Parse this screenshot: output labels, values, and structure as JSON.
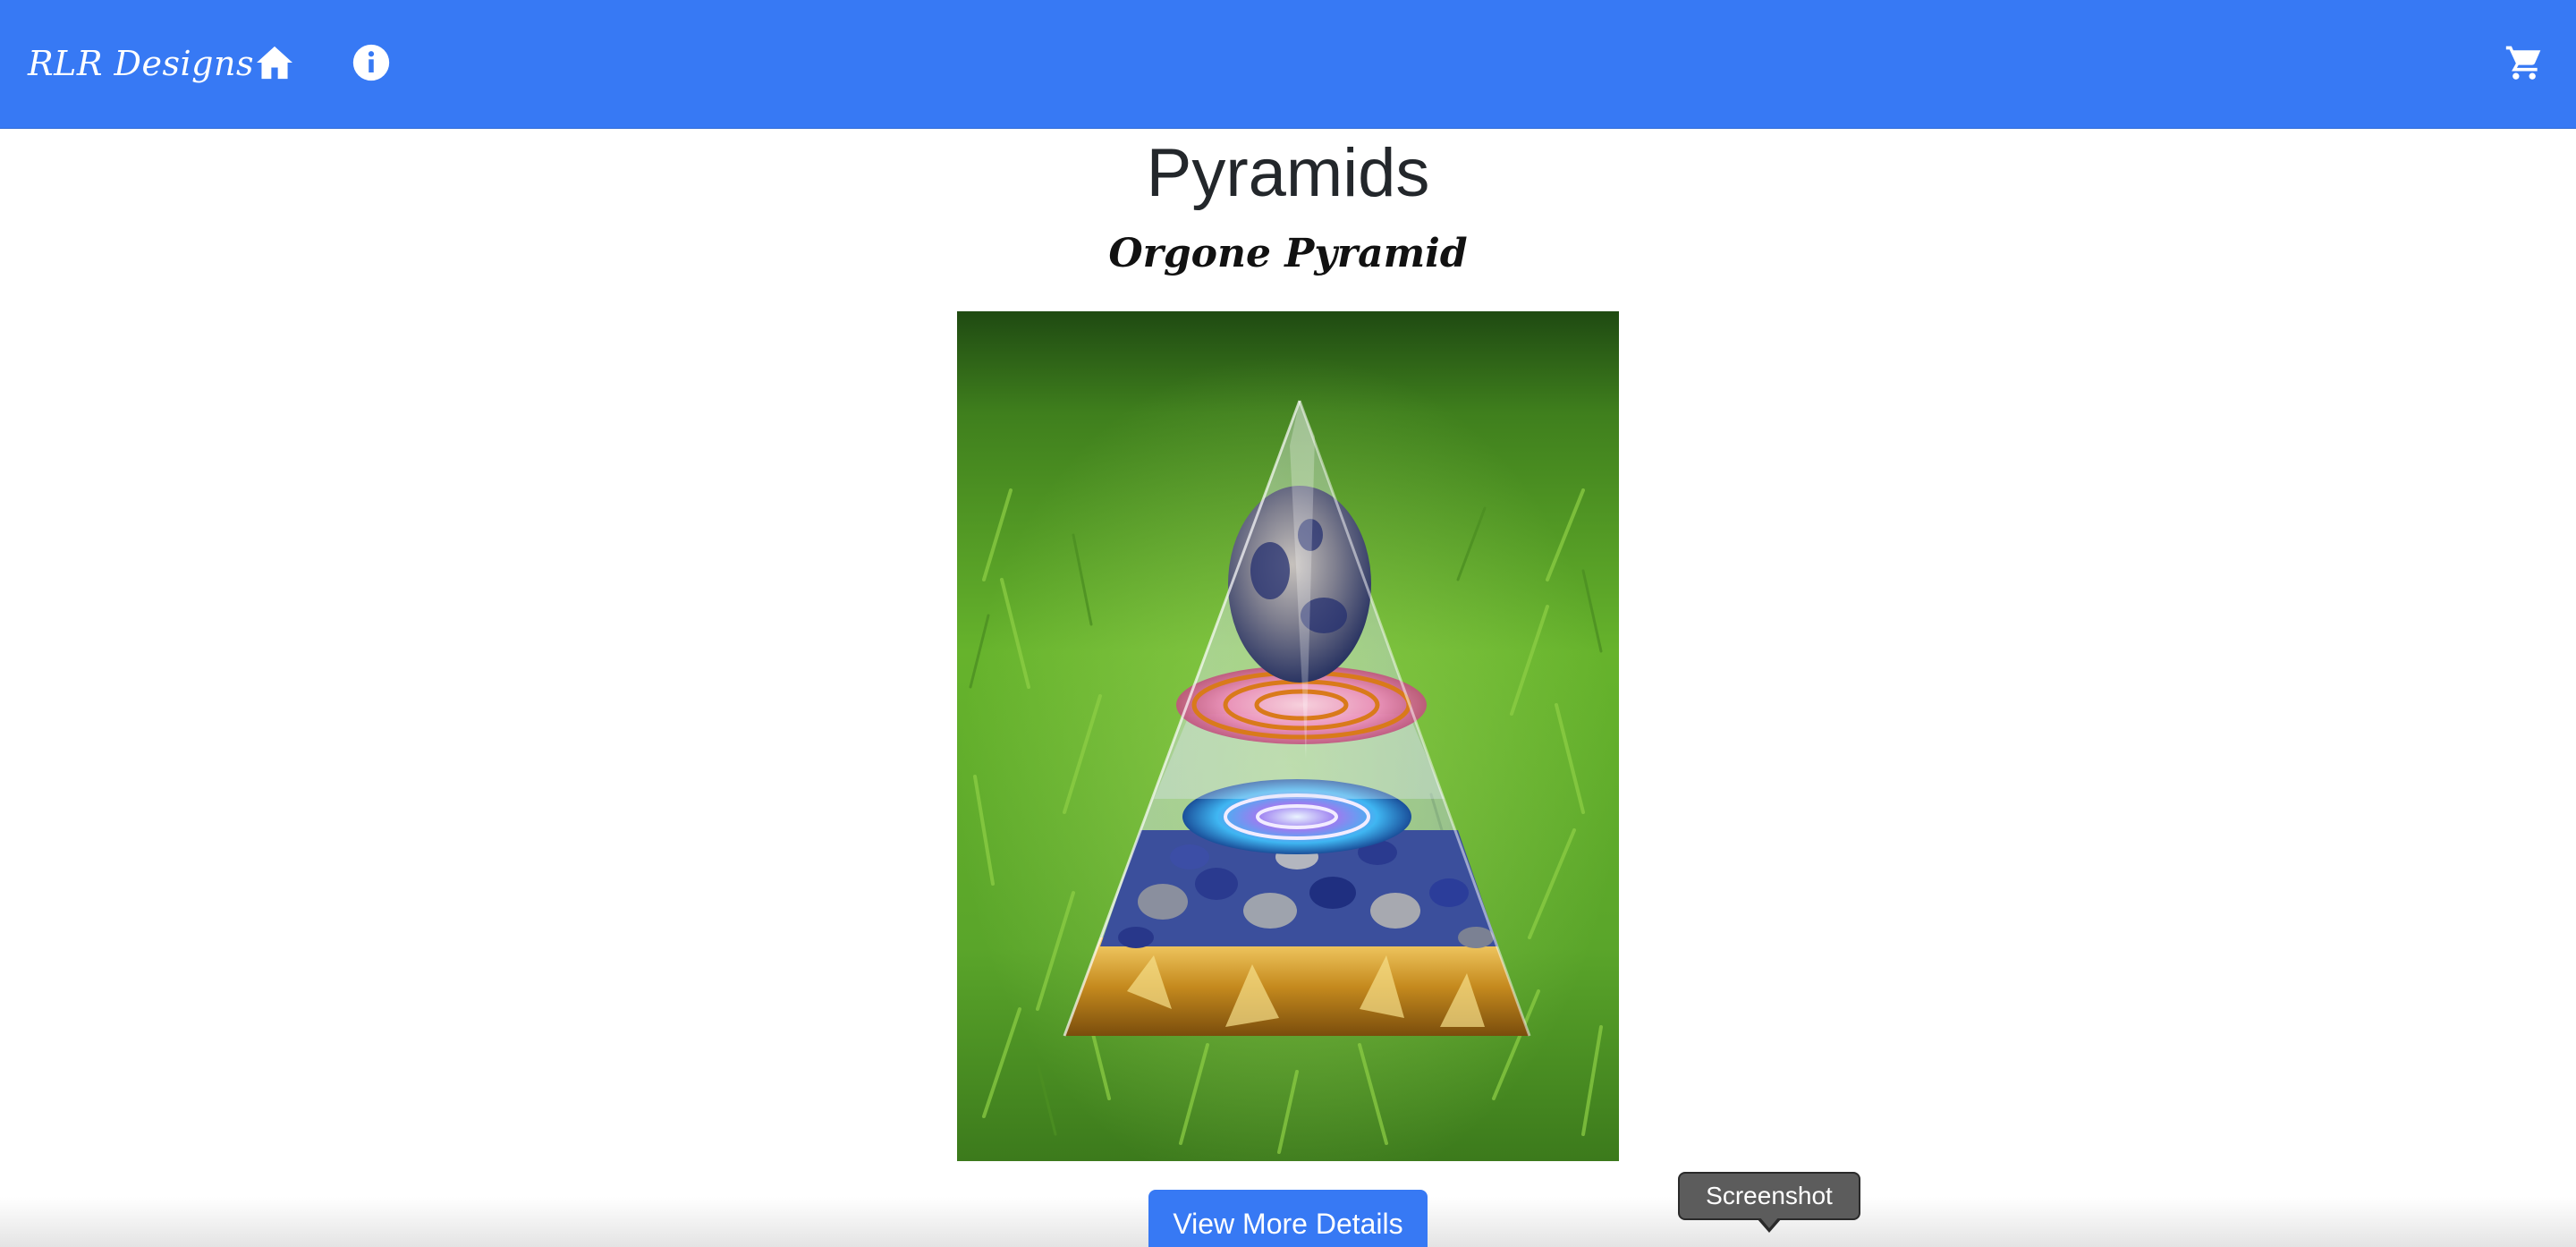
{
  "navbar": {
    "brand": "RLR Designs",
    "icons": {
      "home": "home-icon",
      "info": "info-icon",
      "cart": "cart-icon"
    },
    "color": "#3779f4"
  },
  "main": {
    "title": "Pyramids",
    "subtitle": "Orgone Pyramid",
    "image_alt": "Orgone pyramid on grass",
    "button_label": "View More Details"
  },
  "tooltip": {
    "label": "Screenshot"
  }
}
